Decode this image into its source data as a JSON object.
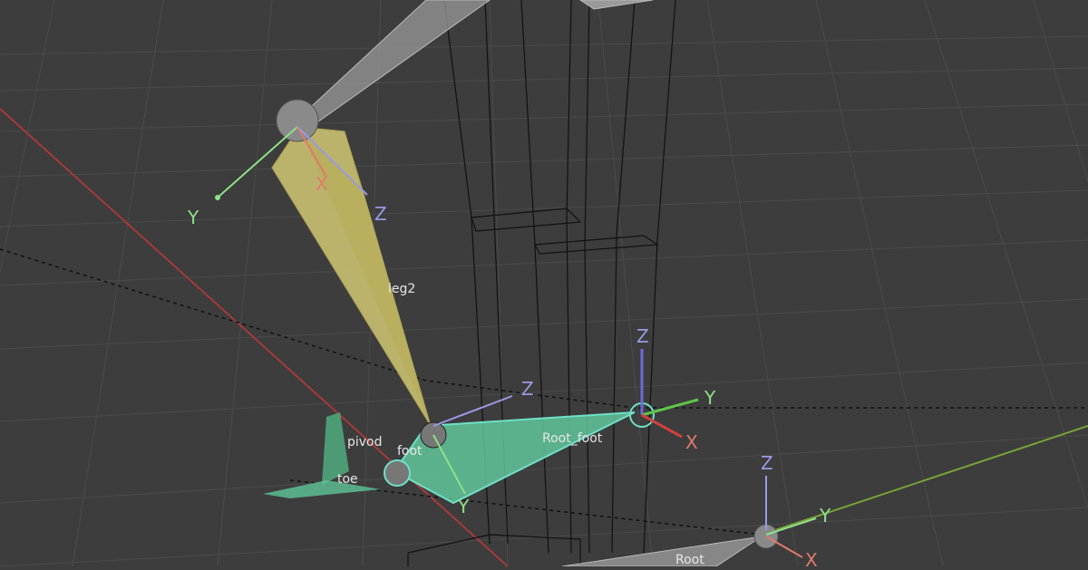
{
  "viewport": {
    "background": "#3d3d3d",
    "grid_color": "#4a4a4a",
    "x_axis_color": "#a63a3a",
    "y_axis_color": "#7aa33a"
  },
  "bones": {
    "leg2": {
      "label": "leg2",
      "color": "#c9c070"
    },
    "root_foot": {
      "label": "Root_foot",
      "color": "#5fc59a"
    },
    "pivod": {
      "label": "pivod"
    },
    "foot": {
      "label": "foot"
    },
    "toe": {
      "label": "toe"
    },
    "root": {
      "label": "Root"
    },
    "upper": {
      "color": "#9a9a9a"
    }
  },
  "gizmos": {
    "leg2_head": {
      "x": "X",
      "y": "Y",
      "z": "Z"
    },
    "foot": {
      "z": "Z",
      "y": "Y"
    },
    "root_foot": {
      "x": "X",
      "y": "Y",
      "z": "Z"
    },
    "root": {
      "x": "X",
      "y": "Y",
      "z": "Z"
    }
  },
  "axis_colors": {
    "x": "#e07a6a",
    "y": "#8fe08a",
    "z": "#9a9ae6"
  }
}
